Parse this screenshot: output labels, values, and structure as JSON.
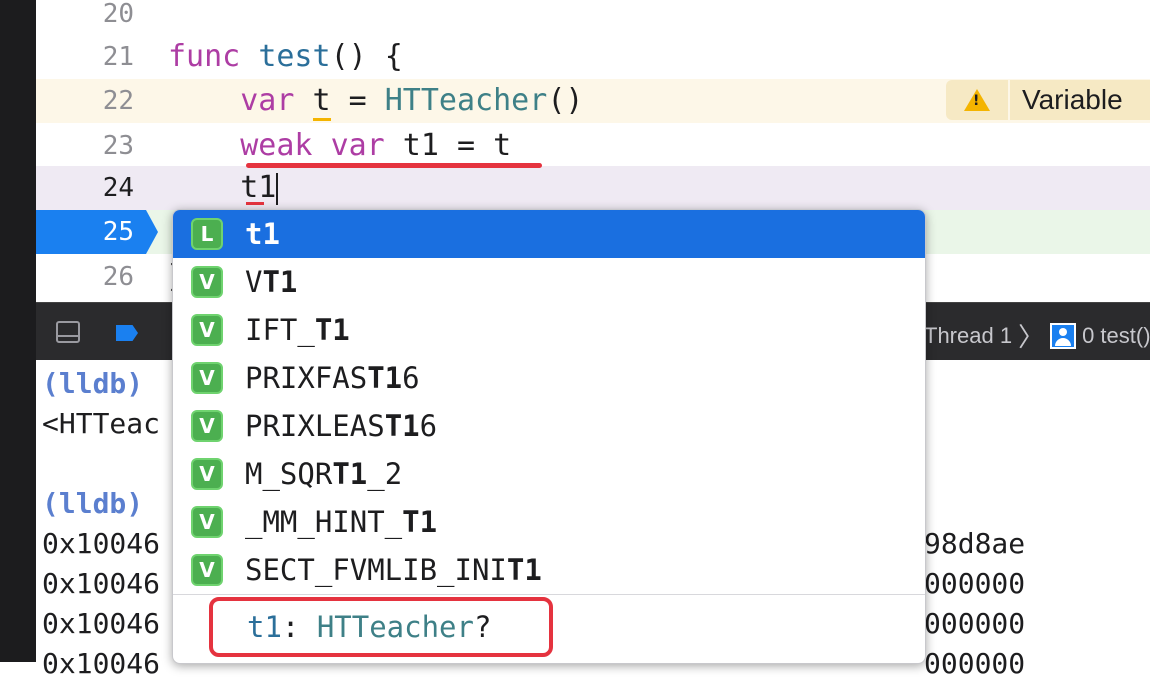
{
  "editor": {
    "lines": [
      {
        "num": "20",
        "tokens": []
      },
      {
        "num": "21",
        "tokens": [
          {
            "t": "func",
            "c": "kw"
          },
          {
            "t": " "
          },
          {
            "t": "test",
            "c": "fn"
          },
          {
            "t": "() {"
          }
        ]
      },
      {
        "num": "22",
        "tokens": [
          {
            "t": "    "
          },
          {
            "t": "var",
            "c": "kw"
          },
          {
            "t": " "
          },
          {
            "t": "t",
            "c": "ul-warn"
          },
          {
            "t": " = "
          },
          {
            "t": "HTTeacher",
            "c": "ty"
          },
          {
            "t": "()"
          }
        ]
      },
      {
        "num": "23",
        "tokens": [
          {
            "t": "    "
          },
          {
            "t": "weak",
            "c": "kw"
          },
          {
            "t": " "
          },
          {
            "t": "var",
            "c": "kw"
          },
          {
            "t": " t1 = t"
          }
        ]
      },
      {
        "num": "24",
        "tokens": [
          {
            "t": "    t1"
          }
        ]
      },
      {
        "num": "25",
        "tokens": []
      },
      {
        "num": "26",
        "tokens": [
          {
            "t": "}"
          }
        ]
      }
    ],
    "warning_text": "Variable"
  },
  "debug_bar": {
    "thread": "Thread 1",
    "frame": "0 test()"
  },
  "console": {
    "lines": [
      {
        "left": "(lldb)",
        "lldb": true,
        "right": ""
      },
      {
        "left": "<HTTeac",
        "lldb": false,
        "right": ""
      },
      {
        "left": "",
        "lldb": false,
        "right": ""
      },
      {
        "left": "(lldb)",
        "lldb": true,
        "right": ""
      },
      {
        "left": "0x10046",
        "lldb": false,
        "right": "98d8ae"
      },
      {
        "left": "0x10046",
        "lldb": false,
        "right": "000000"
      },
      {
        "left": "0x10046",
        "lldb": false,
        "right": "000000"
      },
      {
        "left": "0x10046",
        "lldb": false,
        "right": "000000"
      }
    ]
  },
  "completion": {
    "items": [
      {
        "kind": "L",
        "pre": "",
        "bold": "t1",
        "post": "",
        "selected": true
      },
      {
        "kind": "V",
        "pre": "V",
        "bold": "T1",
        "post": "",
        "selected": false
      },
      {
        "kind": "V",
        "pre": "IFT_",
        "bold": "T1",
        "post": "",
        "selected": false
      },
      {
        "kind": "V",
        "pre": "PRIXFAS",
        "bold": "T1",
        "post": "6",
        "selected": false
      },
      {
        "kind": "V",
        "pre": "PRIXLEAS",
        "bold": "T1",
        "post": "6",
        "selected": false
      },
      {
        "kind": "V",
        "pre": "M_SQR",
        "bold": "T1",
        "post": "_2",
        "selected": false
      },
      {
        "kind": "V",
        "pre": "_MM_HINT_",
        "bold": "T1",
        "post": "",
        "selected": false
      },
      {
        "kind": "V",
        "pre": "SECT_FVMLIB_INI",
        "bold": "T1",
        "post": "",
        "selected": false
      }
    ],
    "detail": {
      "name": "t1",
      "colon": ": ",
      "type": "HTTeacher",
      "suffix": "?"
    }
  },
  "colors": {
    "keyword": "#ad3da4",
    "function": "#2b6f9a",
    "type": "#3e8087",
    "selection": "#1a6fe0",
    "annotation_red": "#e5333f",
    "warning": "#f4b400"
  }
}
